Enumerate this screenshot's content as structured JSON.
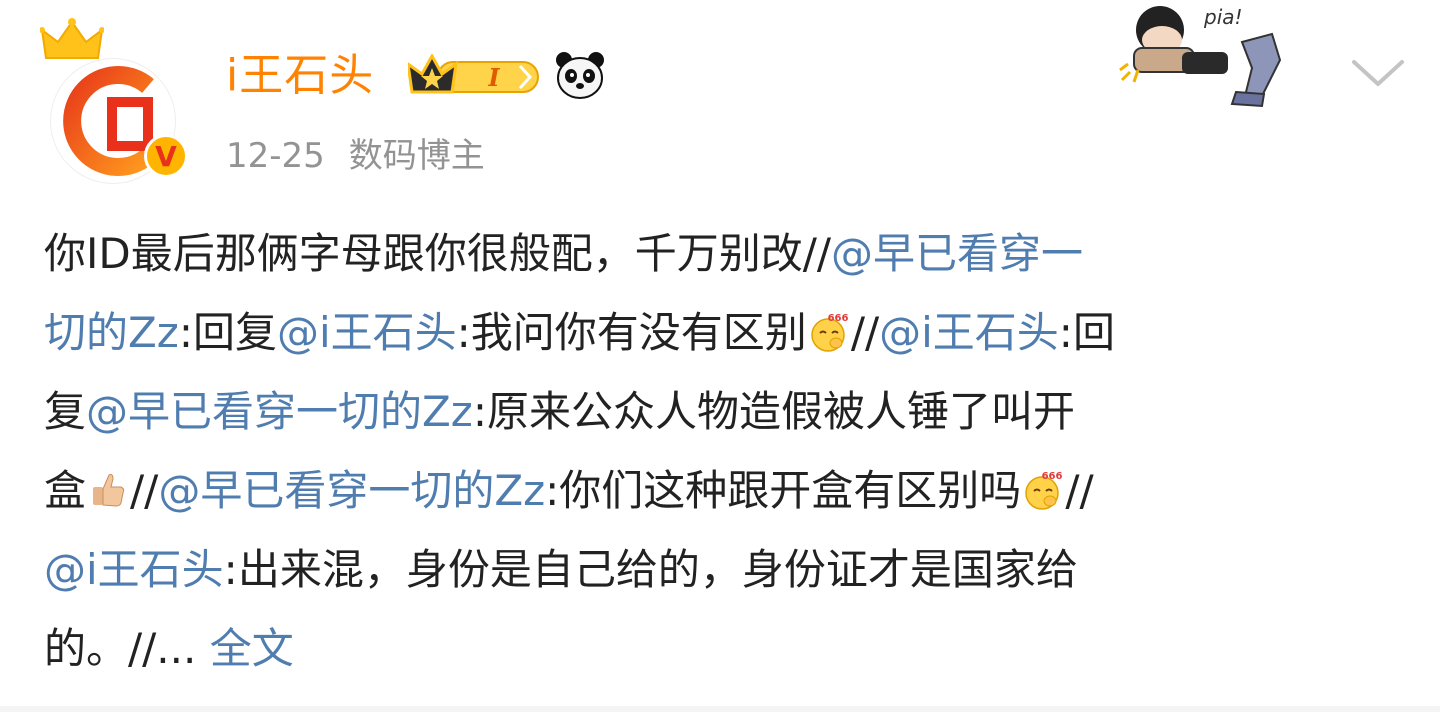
{
  "header": {
    "username": "i王石头",
    "member_level": "I",
    "date": "12-25",
    "tag": "数码博主",
    "verified_mark": "V"
  },
  "post": {
    "lines": [
      [
        {
          "t": "text",
          "v": "你ID最后那俩字母跟你很般配，千万别改//"
        },
        {
          "t": "mention",
          "v": "@早已看穿一"
        }
      ],
      [
        {
          "t": "mention",
          "v": "切的Zz"
        },
        {
          "t": "text",
          "v": ":回复"
        },
        {
          "t": "mention",
          "v": "@i王石头"
        },
        {
          "t": "text",
          "v": ":我问你有没有区别"
        },
        {
          "t": "emoji",
          "v": "666-emoji"
        },
        {
          "t": "text",
          "v": "//"
        },
        {
          "t": "mention",
          "v": "@i王石头"
        },
        {
          "t": "text",
          "v": ":回"
        }
      ],
      [
        {
          "t": "text",
          "v": "复"
        },
        {
          "t": "mention",
          "v": "@早已看穿一切的Zz"
        },
        {
          "t": "text",
          "v": ":原来公众人物造假被人锤了叫开"
        }
      ],
      [
        {
          "t": "text",
          "v": "盒"
        },
        {
          "t": "emoji",
          "v": "thumbs-up-emoji"
        },
        {
          "t": "text",
          "v": "//"
        },
        {
          "t": "mention",
          "v": "@早已看穿一切的Zz"
        },
        {
          "t": "text",
          "v": ":你们这种跟开盒有区别吗"
        },
        {
          "t": "emoji",
          "v": "666-emoji"
        },
        {
          "t": "text",
          "v": "//"
        }
      ],
      [
        {
          "t": "mention",
          "v": "@i王石头"
        },
        {
          "t": "text",
          "v": ":出来混，身份是自己给的，身份证才是国家给"
        }
      ],
      [
        {
          "t": "text",
          "v": "的。//... "
        },
        {
          "t": "link",
          "v": "全文"
        }
      ]
    ]
  },
  "colors": {
    "username": "#ff8200",
    "mention": "#507daf",
    "meta": "#939393",
    "text": "#222222"
  },
  "icons": {
    "crown": "crown-icon",
    "verified": "verified-badge-icon",
    "member": "member-badge-icon",
    "panda": "panda-icon",
    "chevron": "chevron-down-icon",
    "sticker": "pia-sticker"
  },
  "sticker": {
    "text": "pia!"
  }
}
